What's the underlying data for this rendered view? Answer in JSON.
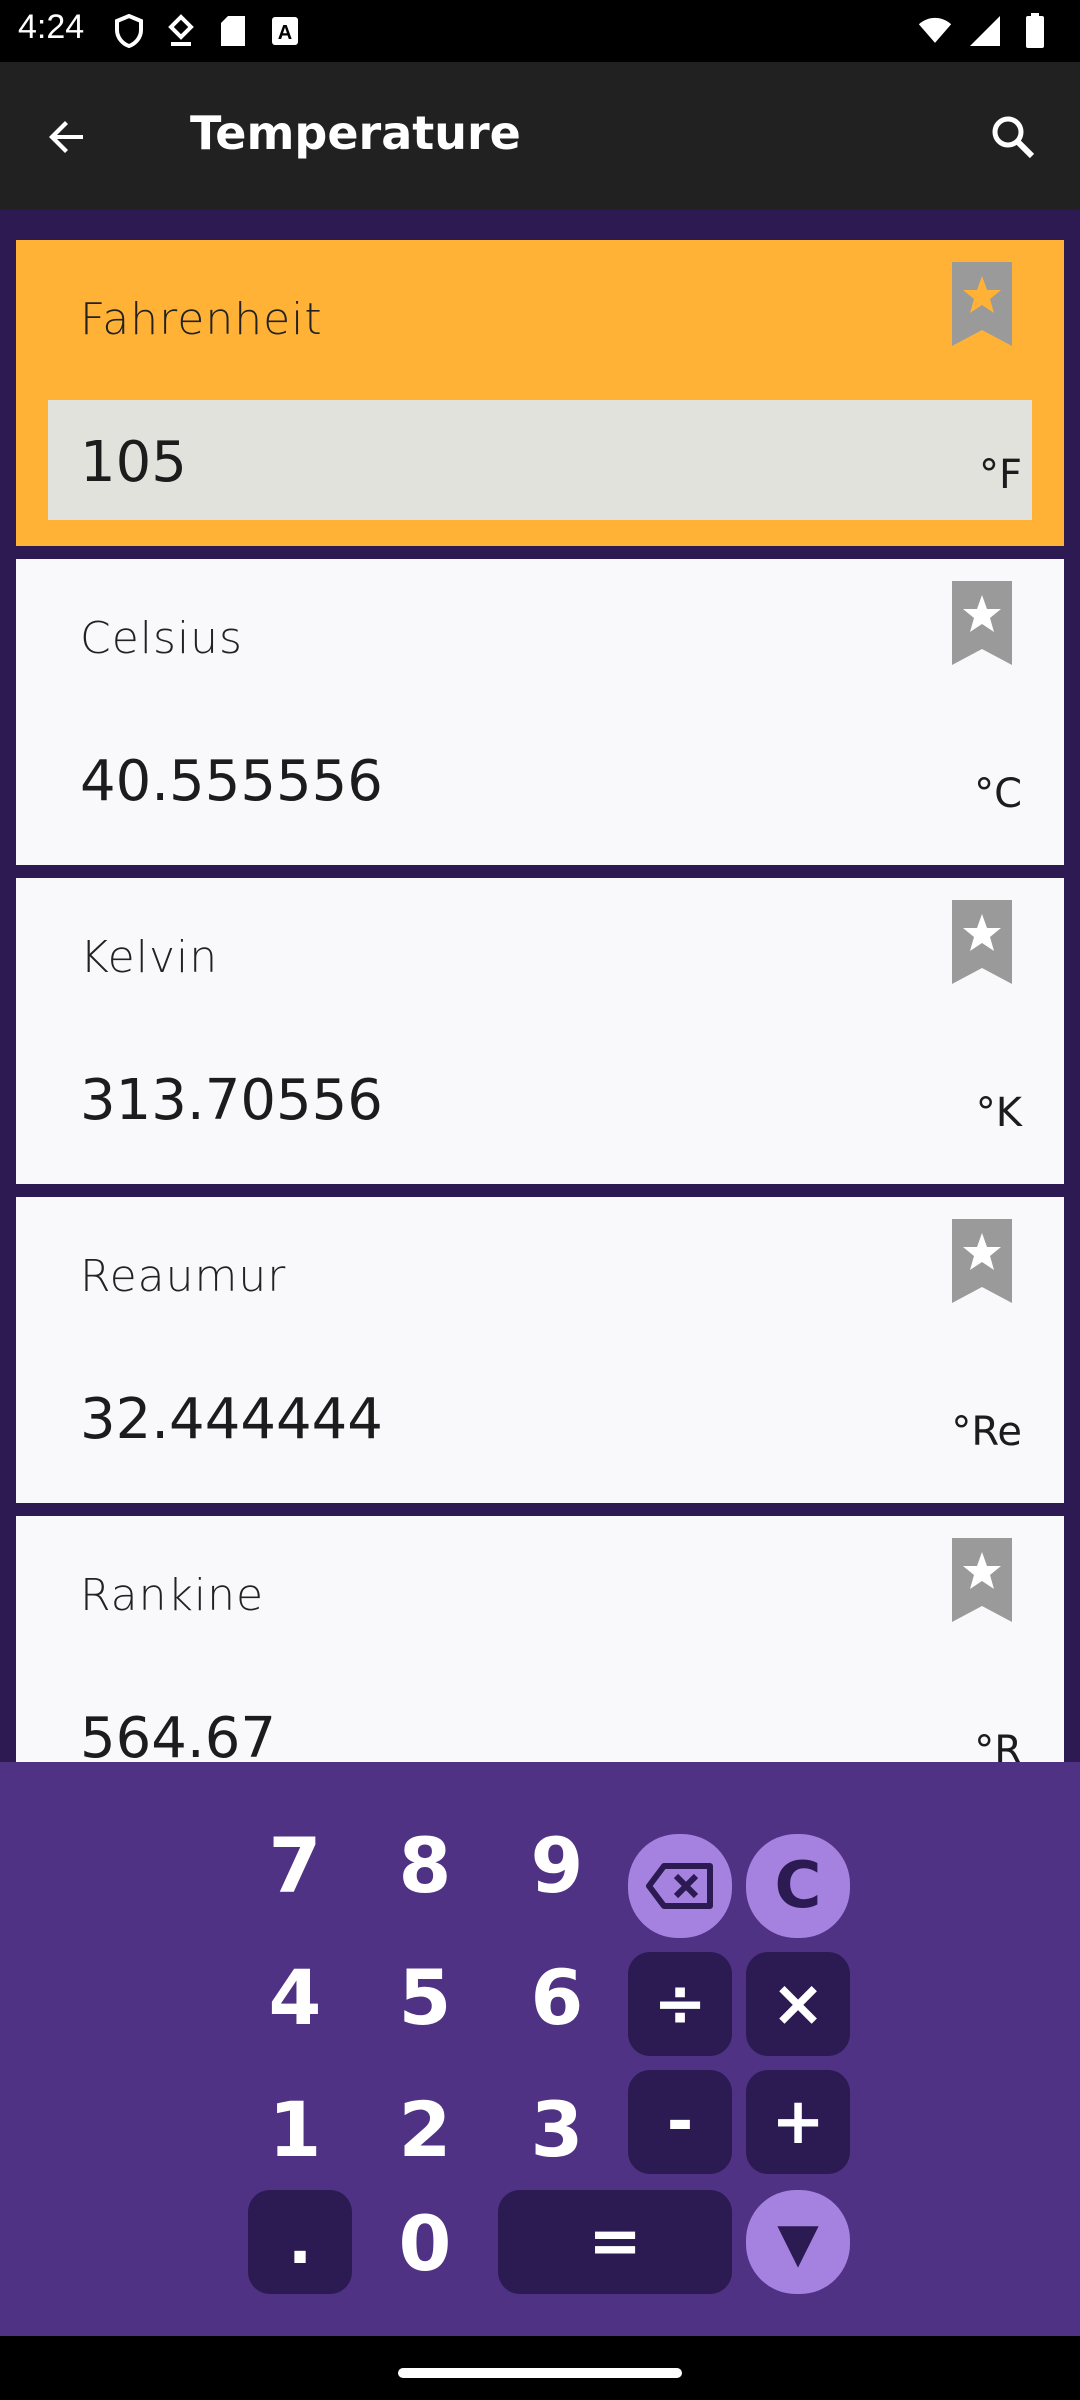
{
  "status_bar": {
    "time": "4:24"
  },
  "app_bar": {
    "title": "Temperature"
  },
  "units": [
    {
      "name": "Fahrenheit",
      "value": "105",
      "symbol": "°F",
      "selected": true
    },
    {
      "name": "Celsius",
      "value": "40.555556",
      "symbol": "°C",
      "selected": false
    },
    {
      "name": "Kelvin",
      "value": "313.70556",
      "symbol": "°K",
      "selected": false
    },
    {
      "name": "Reaumur",
      "value": "32.444444",
      "symbol": "°Re",
      "selected": false
    },
    {
      "name": "Rankine",
      "value": "564.67",
      "symbol": "°R",
      "selected": false
    }
  ],
  "keypad": {
    "digits": {
      "d7": "7",
      "d8": "8",
      "d9": "9",
      "d4": "4",
      "d5": "5",
      "d6": "6",
      "d1": "1",
      "d2": "2",
      "d3": "3",
      "d0": "0"
    },
    "clear": "C",
    "divide": "÷",
    "multiply": "×",
    "minus": "-",
    "plus": "+",
    "decimal": ".",
    "equals": "=",
    "collapse": "▼"
  },
  "colors": {
    "selected_card": "#ffb236",
    "keypad_bg": "#4f3283",
    "key_dark": "#2c1a52",
    "key_light": "#a582e0",
    "list_bg": "#2e1a52"
  },
  "icons": [
    "back-arrow-icon",
    "search-icon",
    "bookmark-star-icon",
    "backspace-icon",
    "wifi-icon",
    "signal-icon",
    "battery-icon"
  ]
}
